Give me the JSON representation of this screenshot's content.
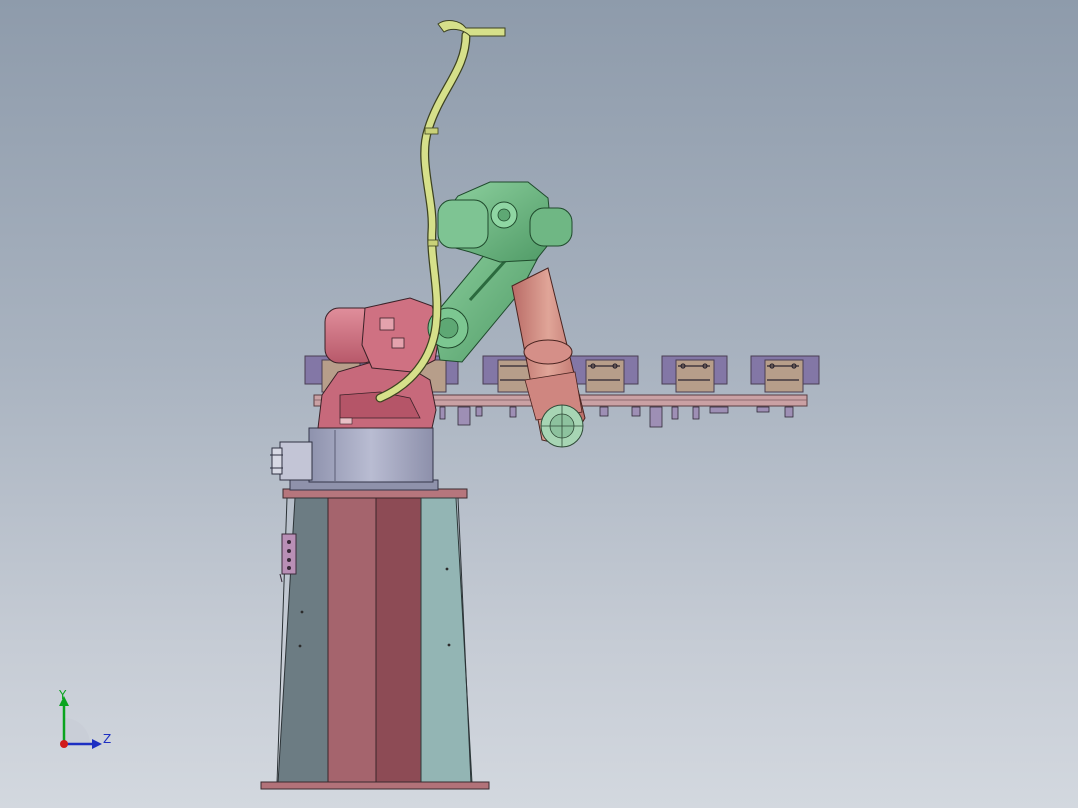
{
  "viewport": {
    "background_top": "#8e9bab",
    "background_bottom": "#d3d8df"
  },
  "triad": {
    "y_label": "Y",
    "z_label": "Z",
    "y_color": "#0aa41e",
    "z_color": "#1d2fc2",
    "x_color": "#d11b1b"
  },
  "model": {
    "parts": [
      "pedestal-column",
      "robot-base",
      "robot-lower-arm",
      "robot-upper-arm",
      "wrist-tool",
      "cable-hose",
      "fixture-rail"
    ],
    "colors": {
      "column_dark": "#6a7a82",
      "column_pink": "#a4636c",
      "column_red": "#8e4c56",
      "column_teal": "#8fb3b3",
      "base_pink": "#c9707e",
      "turret_gray": "#a6a9c2",
      "arm_green": "#6fb784",
      "forearm_salmon": "#c7847b",
      "cable_yellow": "#d6e08a",
      "fixture_tan": "#b59c8a",
      "rail_pink": "#c9a2a4",
      "clamp_purple": "#867aa8"
    }
  }
}
